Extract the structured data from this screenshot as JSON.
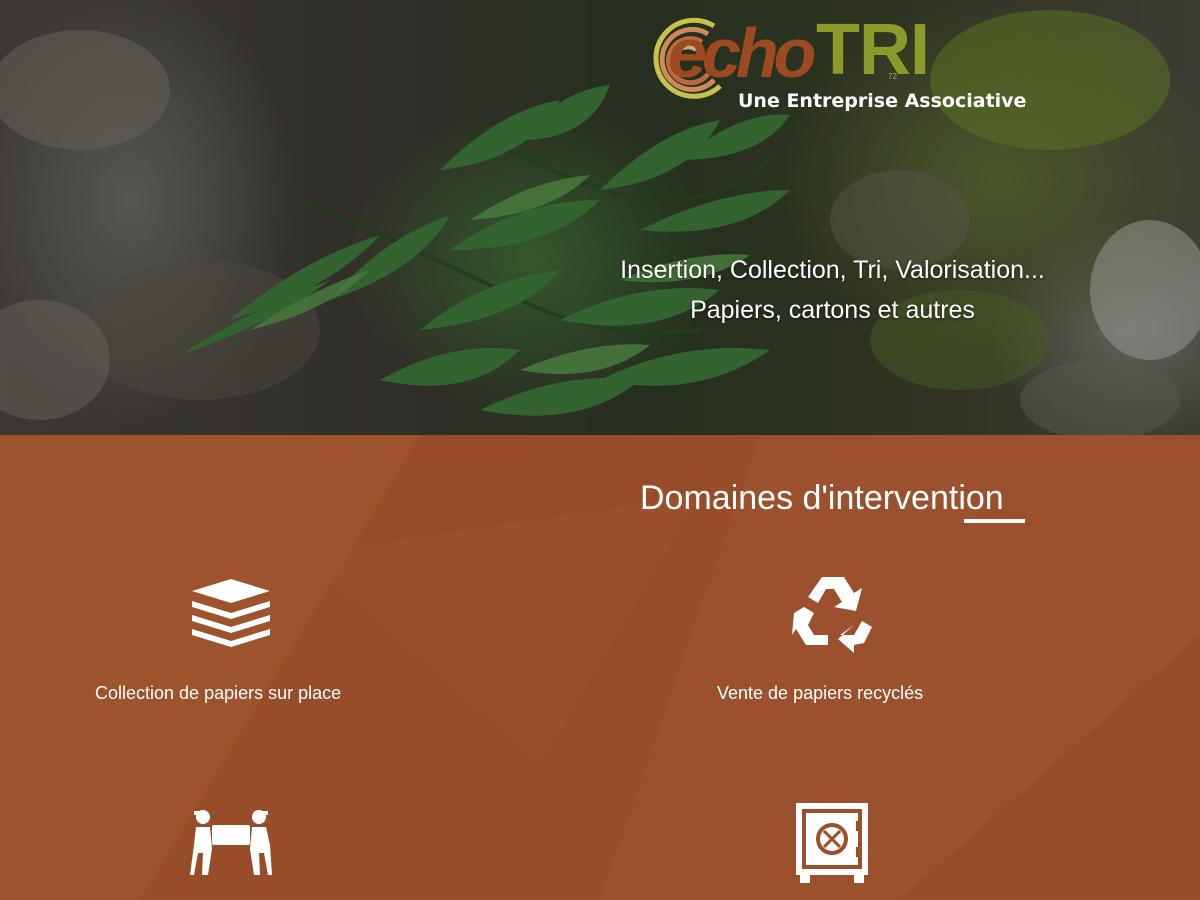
{
  "logo": {
    "echo": "echo",
    "tri": "TRI",
    "small": "72",
    "tagline": "Une Entreprise Associative"
  },
  "hero": {
    "line1": "Insertion, Collection, Tri, Valorisation...",
    "line2": "Papiers, cartons et autres"
  },
  "domaines": {
    "title": "Domaines d'intervention",
    "items": [
      {
        "label": "Collection de papiers sur place",
        "icon": "paper-stack-icon"
      },
      {
        "label": "Vente de papiers recyclés",
        "icon": "recycle-icon"
      },
      {
        "label": "",
        "icon": "movers-icon"
      },
      {
        "label": "",
        "icon": "safe-icon"
      }
    ]
  },
  "colors": {
    "brown": "#9a502a",
    "logo_brown": "#9b4a22",
    "logo_green": "#8b9a28",
    "white": "#ffffff"
  }
}
